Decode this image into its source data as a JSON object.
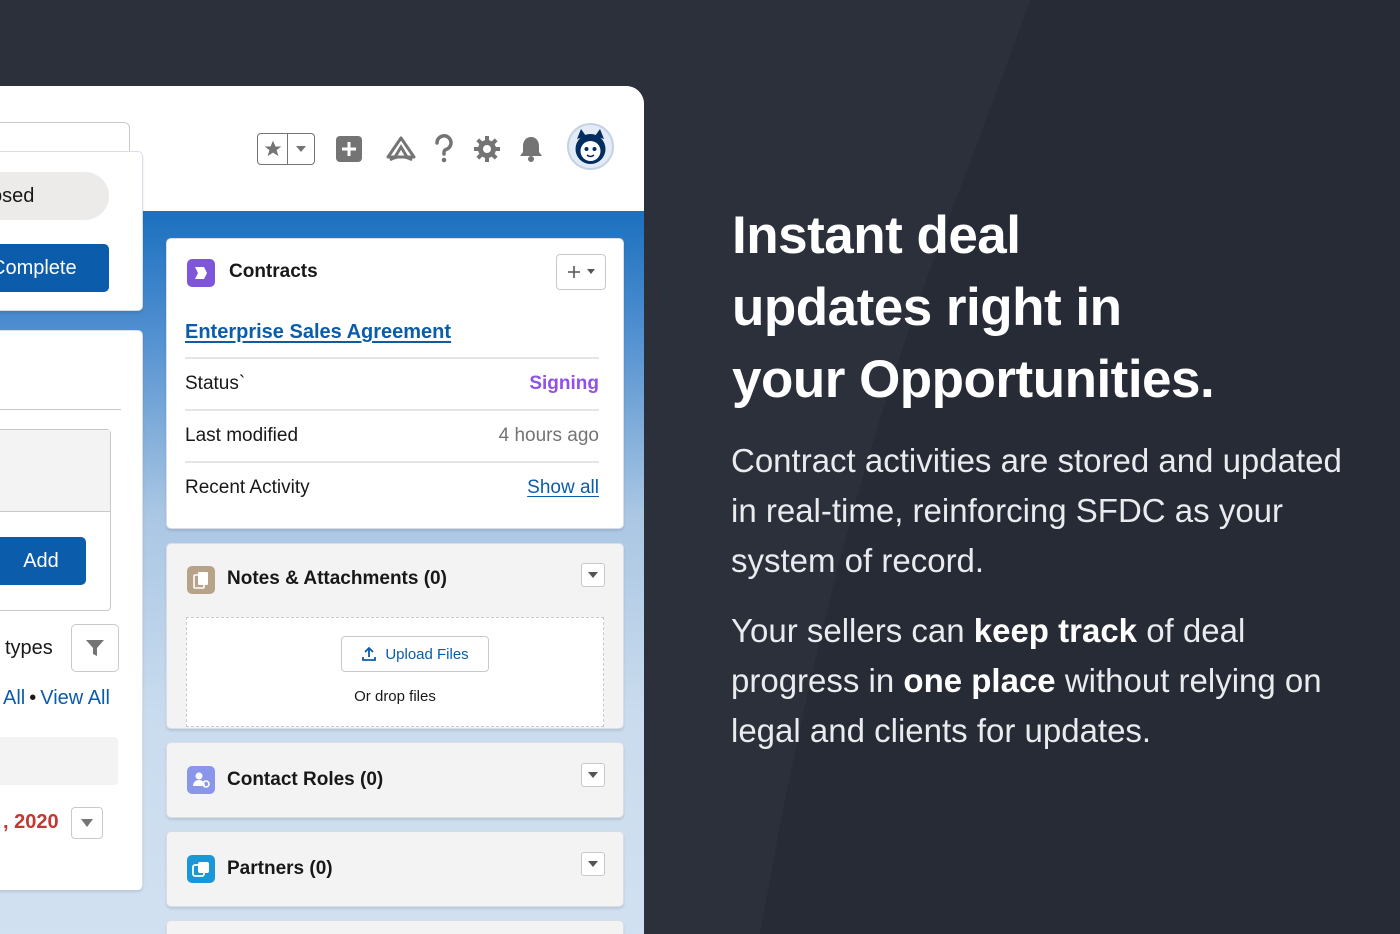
{
  "path": {
    "closed_stage": "osed",
    "complete_button": "Complete"
  },
  "activity": {
    "add_button": "Add",
    "filter_label": "types",
    "link_all": "All",
    "separator": "•",
    "link_view_all": "View All",
    "date_text": ", 2020"
  },
  "contracts": {
    "title": "Contracts",
    "record_link": "Enterprise Sales Agreement",
    "rows": [
      {
        "label": "Status`",
        "value": "Signing"
      },
      {
        "label": "Last modified",
        "value": "4 hours ago"
      },
      {
        "label": "Recent Activity",
        "value": "Show all"
      }
    ]
  },
  "notes": {
    "title": "Notes & Attachments (0)",
    "upload_button": "Upload Files",
    "drop_text": "Or drop files"
  },
  "contact_roles": {
    "title": "Contact Roles (0)"
  },
  "partners": {
    "title": "Partners (0)"
  },
  "header_icons": [
    "star-icon",
    "chevron-down-icon",
    "add-icon",
    "trailhead-icon",
    "help-icon",
    "gear-icon",
    "bell-icon",
    "avatar"
  ],
  "marketing": {
    "headline_lines": [
      "Instant deal",
      "updates right in",
      "your Opportunities."
    ],
    "para1": "Contract activities are stored and updated in real-time, reinforcing SFDC as your system of record.",
    "para2_a": "Your sellers can ",
    "para2_b": "keep track",
    "para2_c": " of deal progress in ",
    "para2_d": "one place",
    "para2_e": " without relying on legal and clients for updates."
  },
  "colors": {
    "background": "#2b303b",
    "brand_blue": "#0b5cab",
    "status_purple": "#9050e9",
    "date_red": "#c23934",
    "contracts_icon": "#7f56d9",
    "notes_icon": "#b7a28a",
    "contacts_icon": "#8a96ea",
    "partners_icon": "#1b96d7"
  }
}
